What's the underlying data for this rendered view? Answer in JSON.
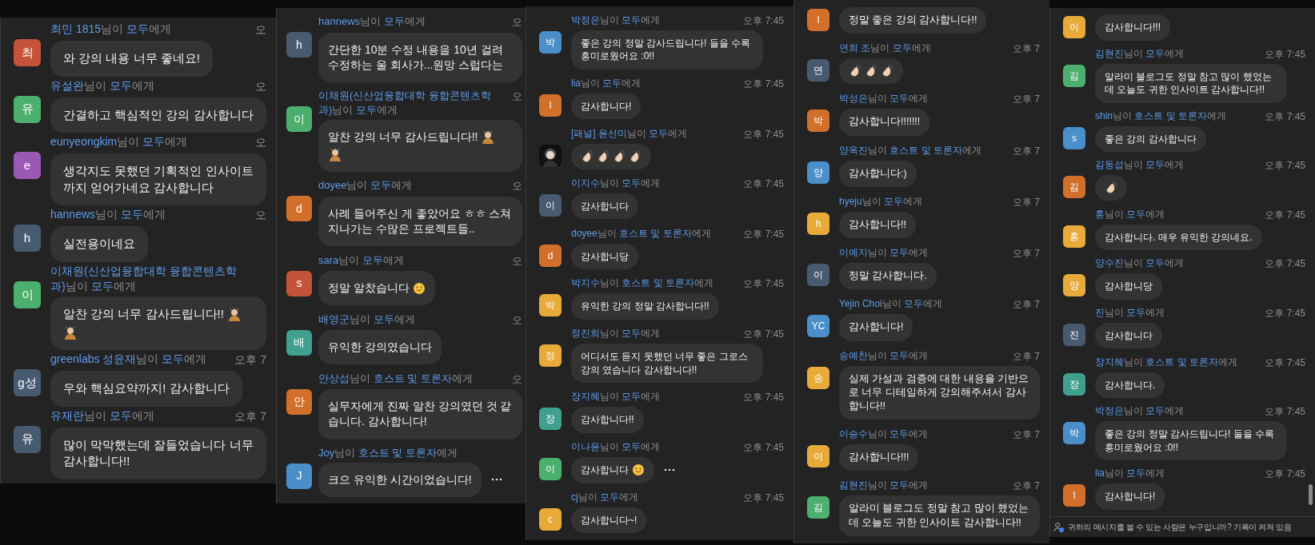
{
  "panels": [
    {
      "messages": [
        {
          "sender": "최민 1815",
          "from_word": "님이",
          "recipient": "모두",
          "to_word": "에게",
          "time": "오",
          "avatar": {
            "initial": "최",
            "color": "#c4533a"
          },
          "text": "와 강의 내용 너무 좋네요!",
          "more": false
        },
        {
          "sender": "유설완",
          "from_word": "님이",
          "recipient": "모두",
          "to_word": "에게",
          "time": "오",
          "avatar": {
            "initial": "유",
            "color": "#4caf6e"
          },
          "text": "간결하고 핵심적인 강의 감사합니다",
          "more": false
        },
        {
          "sender": "eunyeongkim",
          "from_word": "님이",
          "recipient": "모두",
          "to_word": "에게",
          "time": "오",
          "avatar": {
            "initial": "e",
            "color": "#9b59b6"
          },
          "text": "생각지도 못했던 기획적인 인사이트까지 얻어가네요 감사합니다",
          "more": false
        },
        {
          "sender": "hannews",
          "from_word": "님이",
          "recipient": "모두",
          "to_word": "에게",
          "time": "오",
          "avatar": {
            "initial": "h",
            "color": "#475a70"
          },
          "text": "실전용이네요",
          "more": false
        },
        {
          "sender": "이채원(신산업융합대학 융합콘텐츠학과)",
          "from_word": "님이",
          "recipient": "모두",
          "to_word": "에게",
          "avatar": {
            "initial": "이",
            "color": "#4caf6e"
          },
          "text": "알찬 강의 너무 감사드립니다!!",
          "emoji": [
            {
              "kind": "bow"
            },
            {
              "kind": "bow"
            }
          ],
          "more": false
        },
        {
          "sender": "greenlabs 성윤재",
          "from_word": "님이",
          "recipient": "모두",
          "to_word": "에게",
          "time": "오후 7",
          "avatar": {
            "initial": "g성",
            "color": "#475a70"
          },
          "text": "우와 핵심요약까지! 감사합니다",
          "more": false
        },
        {
          "sender": "유재란",
          "from_word": "님이",
          "recipient": "모두",
          "to_word": "에게",
          "time": "오후 7",
          "avatar": {
            "initial": "유",
            "color": "#475a70"
          },
          "text": "많이 막막했는데 잘들었습니다 너무 감사합니다!!",
          "more": false
        }
      ]
    },
    {
      "messages": [
        {
          "sender": "hannews",
          "from_word": "님이",
          "recipient": "모두",
          "to_word": "에게",
          "time": "오",
          "avatar": {
            "initial": "h",
            "color": "#475a70"
          },
          "text": "간단한 10분 수정 내용을 10년 걸려 수정하는 울 회사가...원망 스럽다는",
          "more": false
        },
        {
          "sender": "이채원(신산업융합대학 융합콘텐츠학과)",
          "from_word": "님이",
          "recipient": "모두",
          "to_word": "에게",
          "time": "오",
          "avatar": {
            "initial": "이",
            "color": "#4caf6e"
          },
          "text": "알찬 강의 너무 감사드립니다!!",
          "emoji": [
            {
              "kind": "bow"
            },
            {
              "kind": "bow"
            }
          ],
          "more": false
        },
        {
          "sender": "doyee",
          "from_word": "님이",
          "recipient": "모두",
          "to_word": "에게",
          "time": "오",
          "avatar": {
            "initial": "d",
            "color": "#d26f2a"
          },
          "text": "사례 들어주신 게 좋았어요 ㅎㅎ 스쳐지나가는 수많은 프로젝트들..",
          "more": false
        },
        {
          "sender": "sara",
          "from_word": "님이",
          "recipient": "모두",
          "to_word": "에게",
          "time": "오",
          "avatar": {
            "initial": "s",
            "color": "#c4533a"
          },
          "text": "정말 알찼습니다",
          "emoji": [
            {
              "kind": "smile"
            }
          ],
          "more": false
        },
        {
          "sender": "배영군",
          "from_word": "님이",
          "recipient": "모두",
          "to_word": "에게",
          "time": "오",
          "avatar": {
            "initial": "배",
            "color": "#3fa08f"
          },
          "text": "유익한 강의였습니다",
          "more": false
        },
        {
          "sender": "안상섭",
          "from_word": "님이",
          "recipient": "호스트 및 토론자",
          "to_word": "에게",
          "time": "오",
          "avatar": {
            "initial": "안",
            "color": "#d26f2a"
          },
          "text": "실무자에게 진짜 알찬 강의였던 것 같습니다. 감사합니다!",
          "more": false
        },
        {
          "sender": "Joy",
          "from_word": "님이",
          "recipient": "호스트 및 토론자",
          "to_word": "에게",
          "avatar": {
            "initial": "J",
            "color": "#4a8fc9"
          },
          "text": "크으 유익한 시간이었습니다!",
          "more": true
        }
      ]
    },
    {
      "messages": [
        {
          "sender": "박정은",
          "from_word": "님이",
          "recipient": "모두",
          "to_word": "에게",
          "time": "오후 7:45",
          "avatar": {
            "initial": "박",
            "color": "#4a8fc9"
          },
          "text": "좋은 강의 정말 감사드립니다! 들을 수록 흥미로웠어요 :0!!",
          "more": false
        },
        {
          "sender": "lia",
          "from_word": "님이",
          "recipient": "모두",
          "to_word": "에게",
          "time": "오후 7:45",
          "avatar": {
            "initial": "l",
            "color": "#d26f2a"
          },
          "text": "감사합니다!",
          "more": false
        },
        {
          "sender": "[패널] 윤선미",
          "from_word": "님이",
          "recipient": "모두",
          "to_word": "에게",
          "time": "오후 7:45",
          "avatar": {
            "kind": "picture"
          },
          "emoji": [
            {
              "kind": "clap"
            },
            {
              "kind": "clap"
            },
            {
              "kind": "clap"
            },
            {
              "kind": "clap"
            }
          ],
          "more": false
        },
        {
          "sender": "이지수",
          "from_word": "님이",
          "recipient": "모두",
          "to_word": "에게",
          "time": "오후 7:45",
          "avatar": {
            "initial": "이",
            "color": "#475a70"
          },
          "text": "감사합니다",
          "more": false
        },
        {
          "sender": "doyee",
          "from_word": "님이",
          "recipient": "호스트 및 토론자",
          "to_word": "에게",
          "time": "오후 7:45",
          "avatar": {
            "initial": "d",
            "color": "#d26f2a"
          },
          "text": "감사합니당",
          "more": false
        },
        {
          "sender": "박지수",
          "from_word": "님이",
          "recipient": "호스트 및 토론자",
          "to_word": "에게",
          "time": "오후 7:45",
          "avatar": {
            "initial": "박",
            "color": "#e8ab3a"
          },
          "text": "유익한 강의 정말 감사합니다!!",
          "more": false
        },
        {
          "sender": "정진희",
          "from_word": "님이",
          "recipient": "모두",
          "to_word": "에게",
          "time": "오후 7:45",
          "avatar": {
            "initial": "정",
            "color": "#e8ab3a"
          },
          "text": "어디서도 듣지 못했던 너무 좋은 그로스 강의 였습니다 감사합니다!!",
          "more": false
        },
        {
          "sender": "장지혜",
          "from_word": "님이",
          "recipient": "모두",
          "to_word": "에게",
          "time": "오후 7:45",
          "avatar": {
            "initial": "장",
            "color": "#3fa08f"
          },
          "text": "감사합니다!!",
          "more": false
        },
        {
          "sender": "이나윤",
          "from_word": "님이",
          "recipient": "모두",
          "to_word": "에게",
          "time": "오후 7:45",
          "avatar": {
            "initial": "이",
            "color": "#4caf6e"
          },
          "text": "감사합니다",
          "emoji": [
            {
              "kind": "smile"
            }
          ],
          "more": true
        },
        {
          "sender": "cj",
          "from_word": "님이",
          "recipient": "모두",
          "to_word": "에게",
          "time": "오후 7:45",
          "avatar": {
            "initial": "c",
            "color": "#e8ab3a"
          },
          "text": "감사합니다~!",
          "more": false
        }
      ]
    },
    {
      "messages": [
        {
          "avatar": {
            "initial": "l",
            "color": "#d26f2a"
          },
          "text": "정말 좋은 강의 감사합니다!!",
          "more": false
        },
        {
          "sender": "연희 조",
          "from_word": "님이",
          "recipient": "모두",
          "to_word": "에게",
          "time": "오후 7",
          "avatar": {
            "initial": "연",
            "color": "#475a70"
          },
          "emoji": [
            {
              "kind": "clap"
            },
            {
              "kind": "clap"
            },
            {
              "kind": "clap"
            }
          ],
          "more": false
        },
        {
          "sender": "박성은",
          "from_word": "님이",
          "recipient": "모두",
          "to_word": "에게",
          "time": "오후 7",
          "avatar": {
            "initial": "박",
            "color": "#d26f2a"
          },
          "text": "감사합니다!!!!!!!",
          "more": false
        },
        {
          "sender": "양옥진",
          "from_word": "님이",
          "recipient": "호스트 및 토론자",
          "to_word": "에게",
          "time": "오후 7",
          "avatar": {
            "initial": "양",
            "color": "#4a8fc9"
          },
          "text": "감사합니다:)",
          "more": false
        },
        {
          "sender": "hyeju",
          "from_word": "님이",
          "recipient": "모두",
          "to_word": "에게",
          "time": "오후 7",
          "avatar": {
            "initial": "h",
            "color": "#e8ab3a"
          },
          "text": "감사합니다!!",
          "more": false
        },
        {
          "sender": "이예지",
          "from_word": "님이",
          "recipient": "모두",
          "to_word": "에게",
          "time": "오후 7",
          "avatar": {
            "initial": "이",
            "color": "#475a70"
          },
          "text": "정말 감사합니다.",
          "more": false
        },
        {
          "sender": "Yejin Choi",
          "from_word": "님이",
          "recipient": "모두",
          "to_word": "에게",
          "time": "오후 7",
          "avatar": {
            "initial": "YC",
            "color": "#4a8fc9"
          },
          "text": "감사합니다!",
          "more": false
        },
        {
          "sender": "송예찬",
          "from_word": "님이",
          "recipient": "모두",
          "to_word": "에게",
          "time": "오후 7",
          "avatar": {
            "initial": "송",
            "color": "#e8ab3a"
          },
          "text": "실제 가설과 검증에 대한 내용을 기반으로 너무 디테일하게 강의해주셔서 감사합니다!!",
          "more": false
        },
        {
          "sender": "이승수",
          "from_word": "님이",
          "recipient": "모두",
          "to_word": "에게",
          "time": "오후 7",
          "avatar": {
            "initial": "이",
            "color": "#e8ab3a"
          },
          "text": "감사합니다!!!",
          "more": false
        },
        {
          "sender": "김현진",
          "from_word": "님이",
          "recipient": "모두",
          "to_word": "에게",
          "time": "오후 7",
          "avatar": {
            "initial": "김",
            "color": "#4caf6e"
          },
          "text": "알라미 블로그도 정말 참고 많이 했었는데 오늘도 귀한 인사이트 감사합니다!!",
          "more": false
        }
      ]
    },
    {
      "messages": [
        {
          "avatar": {
            "initial": "이",
            "color": "#e8ab3a"
          },
          "text": "감사합니다!!!",
          "more": false
        },
        {
          "sender": "김현진",
          "from_word": "님이",
          "recipient": "모두",
          "to_word": "에게",
          "time": "오후 7:45",
          "avatar": {
            "initial": "김",
            "color": "#4caf6e"
          },
          "text": "알라미 블로그도 정말 참고 많이 했었는데 오늘도 귀한 인사이트 감사합니다!!",
          "more": false
        },
        {
          "sender": "shin",
          "from_word": "님이",
          "recipient": "호스트 및 토론자",
          "to_word": "에게",
          "time": "오후 7:45",
          "avatar": {
            "initial": "s",
            "color": "#4a8fc9"
          },
          "text": "좋은 강의 감사합니다",
          "more": false
        },
        {
          "sender": "김동섭",
          "from_word": "님이",
          "recipient": "모두",
          "to_word": "에게",
          "time": "오후 7:45",
          "avatar": {
            "initial": "김",
            "color": "#d26f2a"
          },
          "emoji": [
            {
              "kind": "clap"
            }
          ],
          "more": false
        },
        {
          "sender": "홍",
          "from_word": "님이",
          "recipient": "모두",
          "to_word": "에게",
          "time": "오후 7:45",
          "avatar": {
            "initial": "홍",
            "color": "#e8ab3a"
          },
          "text": "감사합니다. 매우 유익한 강의네요.",
          "more": false
        },
        {
          "sender": "양수진",
          "from_word": "님이",
          "recipient": "모두",
          "to_word": "에게",
          "time": "오후 7:45",
          "avatar": {
            "initial": "양",
            "color": "#e8ab3a"
          },
          "text": "감사합니당",
          "more": false
        },
        {
          "sender": "진",
          "from_word": "님이",
          "recipient": "모두",
          "to_word": "에게",
          "time": "오후 7:45",
          "avatar": {
            "initial": "진",
            "color": "#475a70"
          },
          "text": "감사합니다",
          "more": false
        },
        {
          "sender": "장지혜",
          "from_word": "님이",
          "recipient": "호스트 및 토론자",
          "to_word": "에게",
          "time": "오후 7:45",
          "avatar": {
            "initial": "장",
            "color": "#3fa08f"
          },
          "text": "감사합니다.",
          "more": false
        },
        {
          "sender": "박정은",
          "from_word": "님이",
          "recipient": "모두",
          "to_word": "에게",
          "time": "오후 7:45",
          "avatar": {
            "initial": "박",
            "color": "#4a8fc9"
          },
          "text": "좋은 강의 정말 감사드립니다! 들을 수록 흥미로웠어요 :0!!",
          "more": false
        },
        {
          "sender": "lia",
          "from_word": "님이",
          "recipient": "모두",
          "to_word": "에게",
          "time": "오후 7:45",
          "avatar": {
            "initial": "l",
            "color": "#d26f2a"
          },
          "text": "감사합니다!",
          "more": false
        }
      ],
      "footer": "귀하의 메시지를 볼 수 있는 사람은 누구입니까? 기록이 켜져 있음"
    }
  ]
}
